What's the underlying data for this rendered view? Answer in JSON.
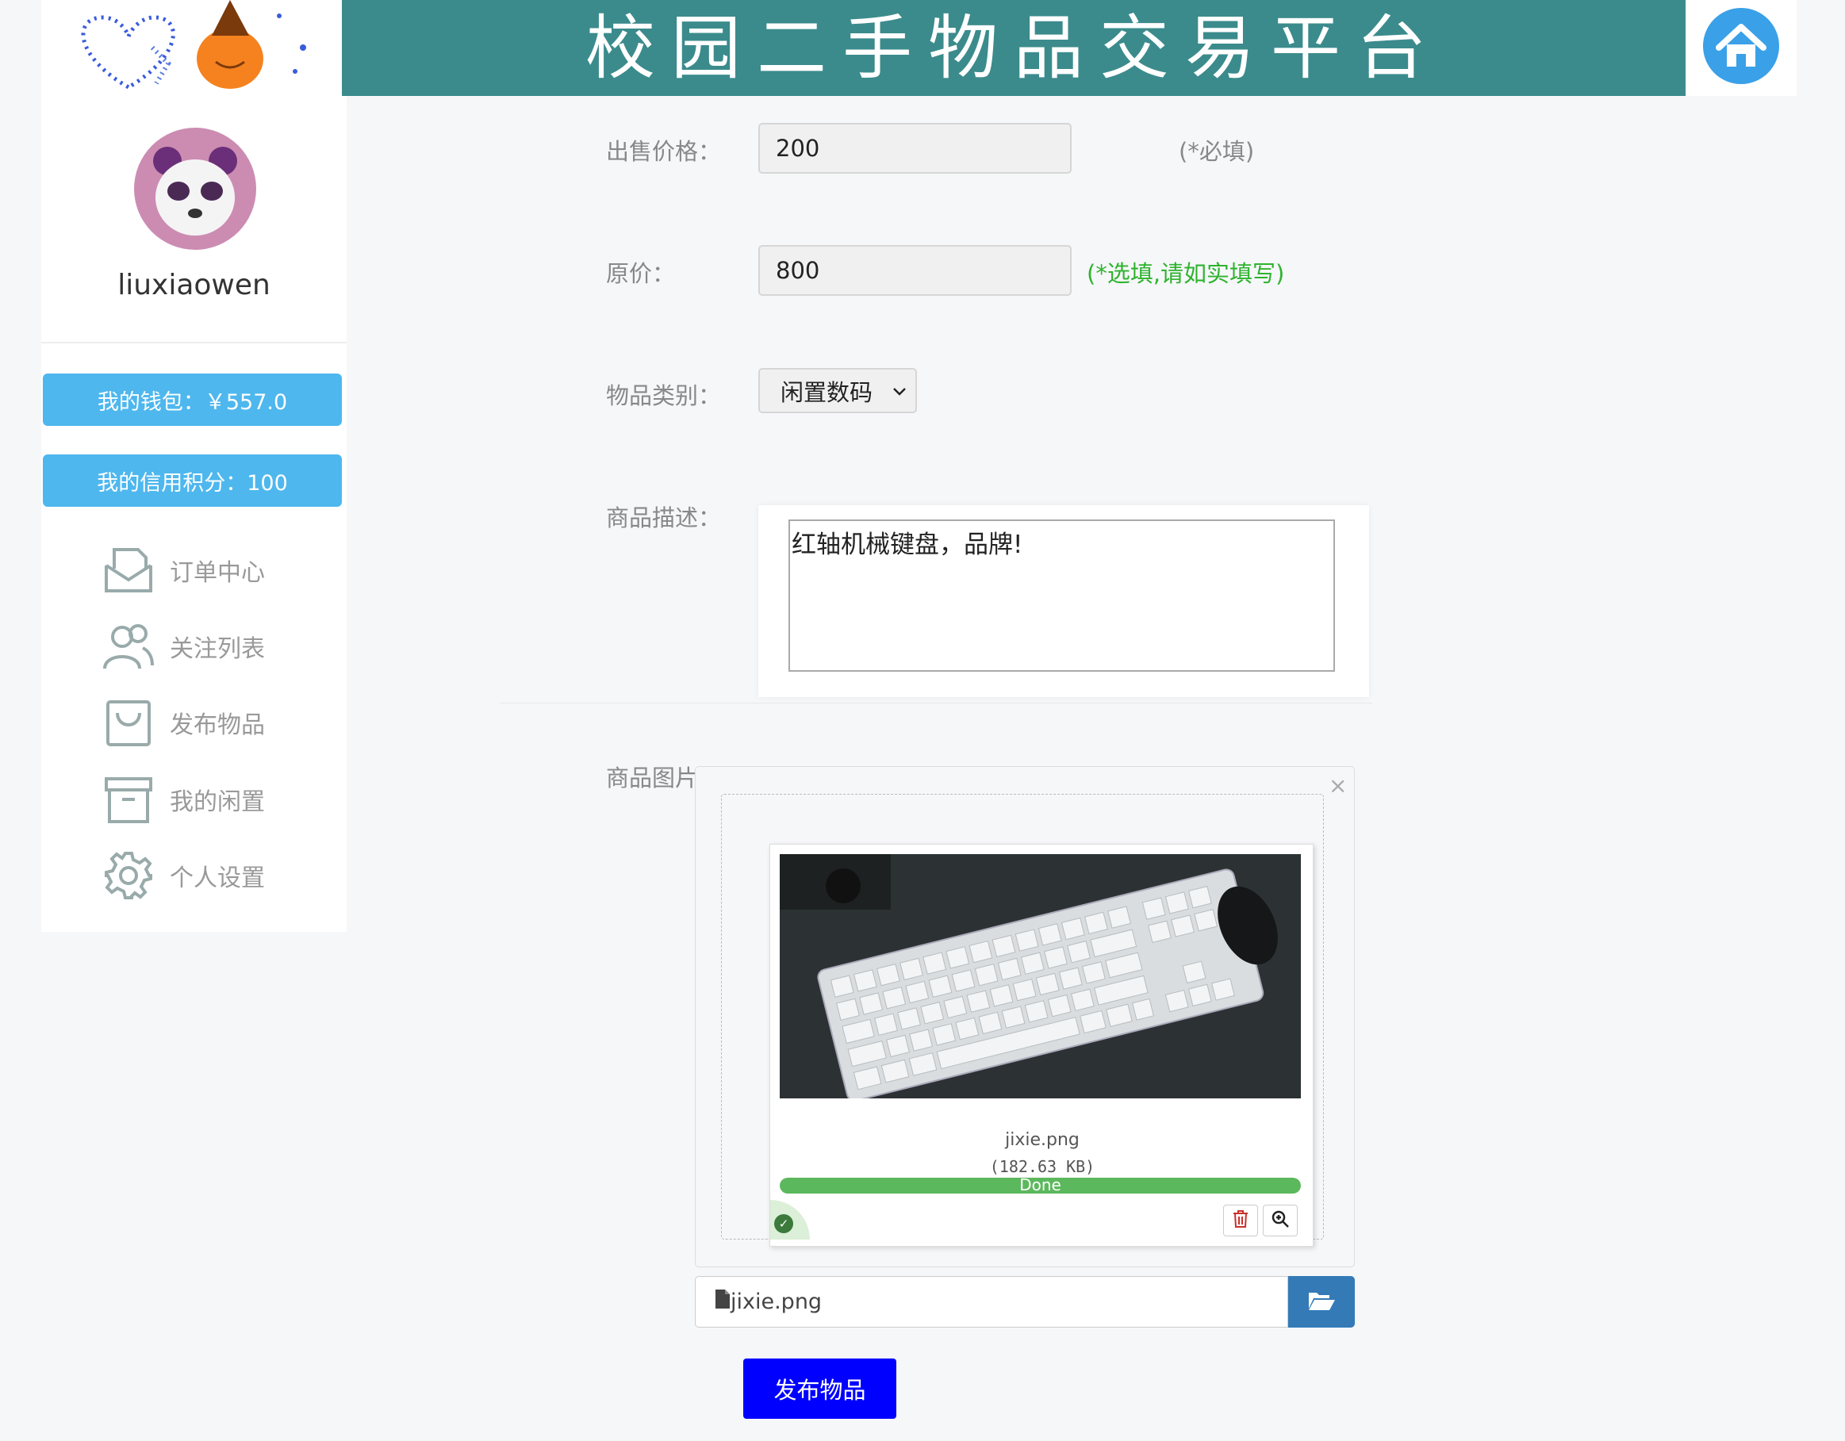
{
  "header": {
    "title": "校园二手物品交易平台",
    "logo_icon": "heart-and-pumpkin-logo",
    "home_icon": "home-icon",
    "banner_color": "#3b8b8c"
  },
  "sidebar": {
    "username": "liuxiaowen",
    "avatar_icon": "panda-avatar",
    "wallet_label": "我的钱包：￥557.0",
    "credit_label": "我的信用积分：100",
    "accent_color": "#4eb7ee",
    "nav": [
      {
        "label": "订单中心",
        "icon": "envelope-icon"
      },
      {
        "label": "关注列表",
        "icon": "users-icon"
      },
      {
        "label": "发布物品",
        "icon": "shopping-bag-icon"
      },
      {
        "label": "我的闲置",
        "icon": "archive-box-icon"
      },
      {
        "label": "个人设置",
        "icon": "gear-icon"
      }
    ]
  },
  "form": {
    "price_label": "出售价格：",
    "price_value": "200",
    "price_note": "(*必填)",
    "original_label": "原价：",
    "original_value": "800",
    "original_note": "(*选填,请如实填写)",
    "category_label": "物品类别：",
    "category_value": "闲置数码",
    "description_label": "商品描述：",
    "description_value": "红轴机械键盘，品牌!",
    "image_label": "商品图片："
  },
  "upload": {
    "file_name": "jixie.png",
    "file_size": "(182.63 KB)",
    "progress_text": "Done",
    "progress_percent": 100,
    "input_value": "jixie.png",
    "close_symbol": "×"
  },
  "submit_label": "发布物品"
}
